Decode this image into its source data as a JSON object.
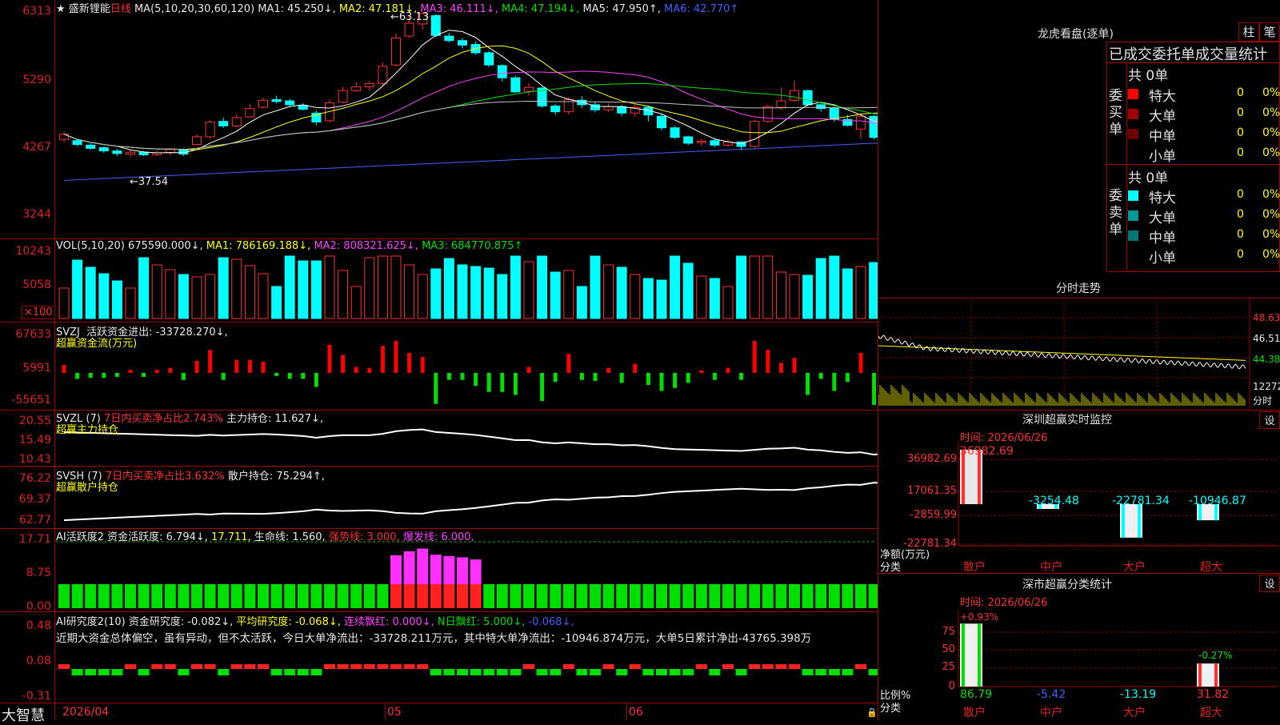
{
  "stock": {
    "name": "盛新锂能",
    "period": "日线",
    "star": "★"
  },
  "main": {
    "ma_header": "MA(5,10,20,30,60,120)",
    "ma1": "MA1: 45.250↓,",
    "ma2": "MA2: 47.181↓,",
    "ma3": "MA3: 46.111↓,",
    "ma4": "MA4: 47.194↓,",
    "ma5": "MA5: 47.950↑,",
    "ma6": "MA6: 42.770↑",
    "yticks": [
      "6313",
      "5290",
      "4267",
      "3244"
    ],
    "high_label": "63.13",
    "low_label": "37.54",
    "colors": {
      "ma1": "#ffffff",
      "ma2": "#ffff00",
      "ma3": "#ff40ff",
      "ma4": "#00e000",
      "ma5": "#c0c0c0",
      "ma6": "#4060ff"
    }
  },
  "vol": {
    "header": "VOL(5,10,20)",
    "val": "675590.000↓,",
    "ma1": "MA1: 786169.188↓,",
    "ma2": "MA2: 808321.625↓,",
    "ma3": "MA3: 684770.875↑",
    "yticks": [
      "10243",
      "5058"
    ],
    "unit": "×100"
  },
  "svzj": {
    "name": "SVZJ",
    "desc": "活跃资金进出: -33728.270↓,",
    "sub": "超赢资金流(万元)",
    "yticks": [
      "67633",
      "5991",
      "-55651"
    ]
  },
  "svzl": {
    "name": "SVZL (7)",
    "desc": "7日内买卖净占比2.743%",
    "hold": "主力持仓: 11.627↓,",
    "sub": "超赢主力持仓",
    "yticks": [
      "20.55",
      "15.49",
      "10.43"
    ]
  },
  "svsh": {
    "name": "SVSH (7)",
    "desc": "7日内买卖净占比3.632%",
    "hold": "散户持仓: 75.294↑,",
    "sub": "超赢散户持仓",
    "yticks": [
      "76.22",
      "69.37",
      "62.77"
    ]
  },
  "ai1": {
    "name": "AI活跃度2",
    "a": "资金活跃度: 6.794↓,",
    "b": "17.711,",
    "c": "生命线: 1.560,",
    "d": "强势线: 3.000,",
    "e": "爆发线: 6.000,",
    "yticks": [
      "17.71",
      "8.75",
      "0.00"
    ]
  },
  "ai2": {
    "name": "AI研究度2(10)",
    "a": "资金研究度: -0.082↓,",
    "b": "平均研究度: -0.068↓,",
    "c": "连续飘红: 0.000↓,",
    "d": "N日飘红: 5.000↓,",
    "e": "-0.068↓,",
    "text": "近期大资金总体偏空，虽有异动，但不太活跃，今日大单净流出：-33728.211万元，其中特大单净流出：-10946.874万元，大单5日累计净出-43765.398万",
    "yticks": [
      "0.48",
      "0.08",
      "-0.31"
    ]
  },
  "bottom": {
    "brand": "大智慧",
    "date": "2026/04",
    "m5": "05",
    "m6": "06"
  },
  "lhb": {
    "title": "龙虎看盘(逐单)",
    "btn1": "柱",
    "btn2": "笔",
    "subtitle": "已成交委托单成交量统计",
    "buy_label": "委买单",
    "sell_label": "委卖单",
    "total": "共 0单",
    "rows": [
      "特大",
      "大单",
      "中单",
      "小单"
    ],
    "zero": "0",
    "pct": "0%",
    "buy_colors": [
      "#ff0000",
      "#a00000",
      "#700000",
      "#000000"
    ],
    "sell_colors": [
      "#00ffff",
      "#009999",
      "#007777",
      "#000000"
    ]
  },
  "intraday": {
    "title": "分时走势",
    "prices": [
      "48.63",
      "46.51",
      "44.38"
    ],
    "vol": "12272",
    "unit": "分时"
  },
  "sz": {
    "title": "深圳超赢实时监控",
    "btn": "设",
    "time": "时间: 2026/06/26",
    "yticks": [
      "36982.69",
      "17061.35",
      "-2859.99",
      "-22781.34"
    ],
    "ylabel": "净额(万元)",
    "xlabel": "分类",
    "cats": [
      "散户",
      "中户",
      "大户",
      "超大"
    ],
    "values": [
      "36982.69",
      "-3254.48",
      "-22781.34",
      "-10946.87"
    ]
  },
  "sh": {
    "title": "深市超赢分类统计",
    "btn": "设",
    "time": "时间: 2026/06/26",
    "yticks": [
      "75",
      "50",
      "25",
      "0"
    ],
    "ylabel": "比例%",
    "xlabel": "分类",
    "cats": [
      "散户",
      "中户",
      "大户",
      "超大"
    ],
    "values": [
      "86.79",
      "-5.42",
      "-13.19",
      "31.82"
    ],
    "top1": "+0.93%",
    "top4": "-0.27%"
  },
  "chart_data": {
    "type": "candlestick",
    "candles": [
      [
        4340,
        4420,
        4300,
        4460
      ],
      [
        4320,
        4260,
        4230,
        4350
      ],
      [
        4250,
        4200,
        4180,
        4280
      ],
      [
        4210,
        4160,
        4130,
        4230
      ],
      [
        4160,
        4120,
        4080,
        4190
      ],
      [
        4110,
        4140,
        4070,
        4170
      ],
      [
        4140,
        4100,
        4080,
        4160
      ],
      [
        4100,
        4130,
        4080,
        4170
      ],
      [
        4130,
        4180,
        4090,
        4200
      ],
      [
        4180,
        4110,
        4080,
        4200
      ],
      [
        4260,
        4380,
        4250,
        4420
      ],
      [
        4380,
        4610,
        4350,
        4640
      ],
      [
        4620,
        4550,
        4520,
        4680
      ],
      [
        4550,
        4680,
        4530,
        4730
      ],
      [
        4690,
        4820,
        4680,
        4890
      ],
      [
        4840,
        4950,
        4820,
        4990
      ],
      [
        4960,
        4930,
        4900,
        5020
      ],
      [
        4940,
        4880,
        4850,
        4970
      ],
      [
        4870,
        4810,
        4790,
        4900
      ],
      [
        4750,
        4610,
        4560,
        4790
      ],
      [
        4630,
        4910,
        4600,
        4960
      ],
      [
        4920,
        5100,
        4900,
        5160
      ],
      [
        5100,
        5160,
        5080,
        5230
      ],
      [
        5160,
        5210,
        5100,
        5250
      ],
      [
        5210,
        5480,
        5180,
        5540
      ],
      [
        5500,
        5920,
        5480,
        5990
      ],
      [
        5950,
        6150,
        5920,
        6260
      ],
      [
        6140,
        6300,
        6050,
        6313
      ],
      [
        6270,
        5960,
        5930,
        6290
      ],
      [
        5950,
        5880,
        5850,
        6000
      ],
      [
        5880,
        5810,
        5760,
        5920
      ],
      [
        5820,
        5690,
        5660,
        5870
      ],
      [
        5690,
        5500,
        5470,
        5720
      ],
      [
        5490,
        5300,
        5240,
        5510
      ],
      [
        5300,
        5080,
        5060,
        5330
      ],
      [
        5090,
        5150,
        5020,
        5220
      ],
      [
        5140,
        4860,
        4830,
        5160
      ],
      [
        4860,
        4770,
        4720,
        4890
      ],
      [
        4770,
        4960,
        4730,
        5000
      ],
      [
        4950,
        4880,
        4830,
        5010
      ],
      [
        4880,
        4800,
        4760,
        4920
      ],
      [
        4800,
        4850,
        4770,
        4900
      ],
      [
        4850,
        4750,
        4700,
        4880
      ],
      [
        4750,
        4840,
        4700,
        4880
      ],
      [
        4840,
        4720,
        4620,
        4860
      ],
      [
        4700,
        4520,
        4480,
        4730
      ],
      [
        4520,
        4370,
        4350,
        4550
      ],
      [
        4380,
        4280,
        4250,
        4400
      ],
      [
        4290,
        4310,
        4240,
        4350
      ],
      [
        4320,
        4250,
        4220,
        4360
      ],
      [
        4250,
        4300,
        4220,
        4340
      ],
      [
        4300,
        4230,
        4170,
        4310
      ],
      [
        4230,
        4620,
        4210,
        4650
      ],
      [
        4620,
        4850,
        4600,
        4880
      ],
      [
        4840,
        4940,
        4800,
        5150
      ],
      [
        4950,
        5100,
        4920,
        5260
      ],
      [
        5100,
        4880,
        4860,
        5120
      ],
      [
        4880,
        4820,
        4770,
        4900
      ],
      [
        4830,
        4650,
        4610,
        4850
      ],
      [
        4650,
        4560,
        4540,
        4720
      ],
      [
        4500,
        4700,
        4350,
        4730
      ],
      [
        4700,
        4370,
        4340,
        4720
      ],
      [
        4380,
        4700,
        4360,
        4730
      ],
      [
        4690,
        4650,
        4580,
        4850
      ],
      [
        4620,
        4320,
        4290,
        4650
      ]
    ]
  }
}
